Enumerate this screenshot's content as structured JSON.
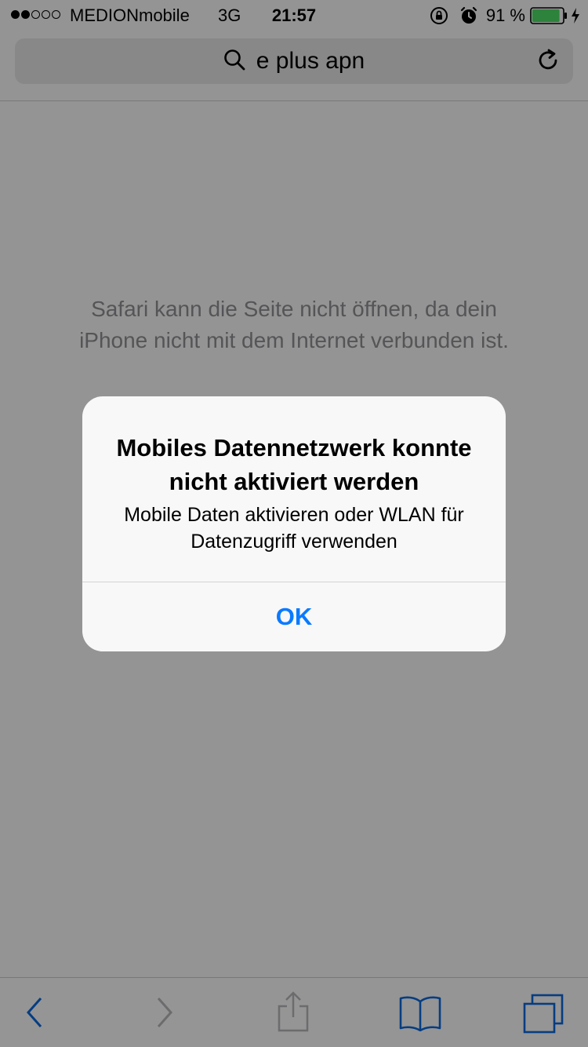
{
  "status_bar": {
    "carrier": "MEDIONmobile",
    "network": "3G",
    "time": "21:57",
    "battery_percent": "91 %",
    "battery_level": 0.91,
    "signal_strength": 2,
    "signal_max": 5
  },
  "url_bar": {
    "query": "e plus apn"
  },
  "page": {
    "error_message": "Safari kann die Seite nicht öffnen, da dein iPhone nicht mit dem Internet verbunden ist."
  },
  "alert": {
    "title": "Mobiles Datennetzwerk konnte nicht aktiviert werden",
    "message": "Mobile Daten aktivieren oder WLAN für Datenzugriff verwenden",
    "ok_label": "OK"
  },
  "icons": {
    "search": "search-icon",
    "reload": "reload-icon",
    "back": "back-icon",
    "forward": "forward-icon",
    "share": "share-icon",
    "bookmarks": "bookmarks-icon",
    "tabs": "tabs-icon",
    "orientation_lock": "orientation-lock-icon",
    "alarm": "alarm-icon",
    "battery": "battery-icon",
    "charging": "charging-icon"
  },
  "colors": {
    "accent": "#0a7aff",
    "toolbar_tint": "#0a66d8",
    "disabled": "#b4b4b8",
    "battery_fill": "#4cd964"
  }
}
